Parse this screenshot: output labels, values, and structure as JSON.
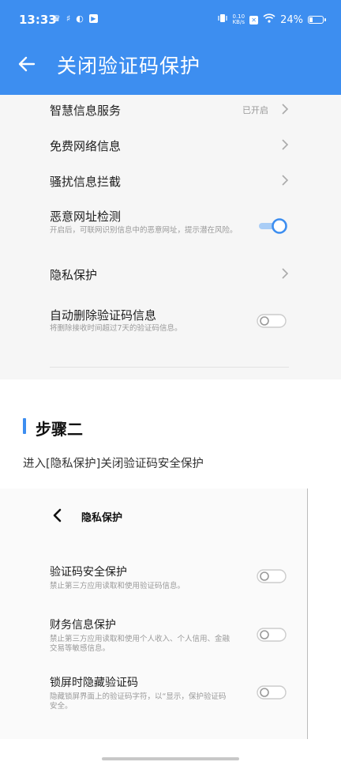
{
  "status_bar": {
    "time": "13:33",
    "net_speed_value": "0.10",
    "net_speed_unit": "KB/s",
    "battery": "24%",
    "battery_level": 0.24
  },
  "header": {
    "title": "关闭验证码保护",
    "background": "#3d8ef0"
  },
  "settings": {
    "smart_info": {
      "label": "智慧信息服务",
      "value": "已开启"
    },
    "free_network": {
      "label": "免费网络信息"
    },
    "harassment": {
      "label": "骚扰信息拦截"
    },
    "malicious_url": {
      "label": "恶意网址检测",
      "desc": "开启后，可联网识别信息中的恶意网址，提示潜在风险。",
      "on": true
    },
    "privacy": {
      "label": "隐私保护"
    },
    "auto_delete": {
      "label": "自动删除验证码信息",
      "desc": "将删除接收时间超过7天的验证码信息。",
      "on": false
    }
  },
  "step": {
    "title": "步骤二",
    "desc": "进入[隐私保护]关闭验证码安全保护",
    "accent": "#3d8ef0"
  },
  "privacy_screen": {
    "title": "隐私保护",
    "items": [
      {
        "label": "验证码安全保护",
        "desc": "禁止第三方应用读取和使用验证码信息。",
        "on": false
      },
      {
        "label": "财务信息保护",
        "desc": "禁止第三方应用读取和使用个人收入、个人信用、金融交易等敏感信息。",
        "on": false
      },
      {
        "label": "锁屏时隐藏验证码",
        "desc": "隐藏锁屏界面上的验证码字符，以“显示，保护验证码安全。",
        "on": false
      }
    ]
  }
}
